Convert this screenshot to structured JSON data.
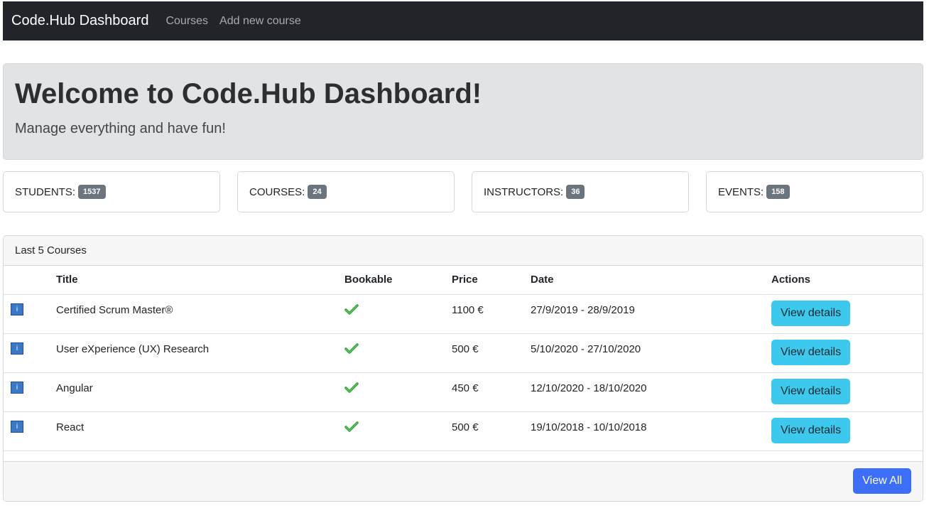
{
  "navbar": {
    "brand": "Code.Hub Dashboard",
    "links": [
      "Courses",
      "Add new course"
    ]
  },
  "jumbotron": {
    "title": "Welcome to Code.Hub Dashboard!",
    "subtitle": "Manage everything and have fun!"
  },
  "stats": [
    {
      "label": "STUDENTS:",
      "value": "1537"
    },
    {
      "label": "COURSES:",
      "value": "24"
    },
    {
      "label": "INSTRUCTORS:",
      "value": "36"
    },
    {
      "label": "EVENTS:",
      "value": "158"
    }
  ],
  "courses_card": {
    "header": "Last 5 Courses",
    "columns": [
      "Title",
      "Bookable",
      "Price",
      "Date",
      "Actions"
    ],
    "rows": [
      {
        "icon": "i",
        "title": "Certified Scrum Master®",
        "price": "1100 €",
        "date": "27/9/2019 - 28/9/2019",
        "action": "View details"
      },
      {
        "icon": "i",
        "title": "User eXperience (UX) Research",
        "price": "500 €",
        "date": "5/10/2020 - 27/10/2020",
        "action": "View details"
      },
      {
        "icon": "i",
        "title": "Angular",
        "price": "450 €",
        "date": "12/10/2020 - 18/10/2020",
        "action": "View details"
      },
      {
        "icon": "i",
        "title": "React",
        "price": "500 €",
        "date": "19/10/2018 - 10/10/2018",
        "action": "View details"
      }
    ],
    "footer_button": "View All"
  },
  "colors": {
    "navbar_bg": "#212529",
    "jumbotron_bg": "#e2e3e5",
    "badge_bg": "#6c757d",
    "details_button": "#3dc9ee",
    "view_all_button": "#3d6ef7",
    "check_green": "#2e9e3a"
  }
}
